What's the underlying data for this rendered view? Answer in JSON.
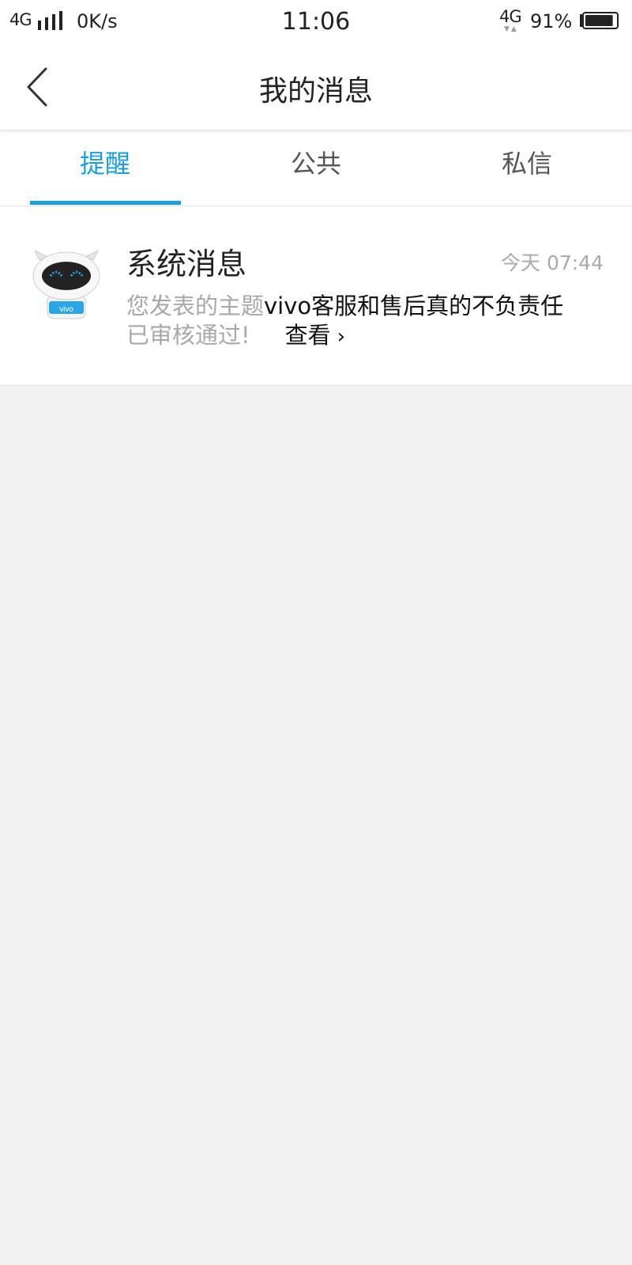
{
  "status_bar": {
    "network_left": "4G",
    "speed": "0K/s",
    "time": "11:06",
    "network_right": "4G",
    "battery": "91%",
    "battery_level": 0.91
  },
  "nav": {
    "title": "我的消息"
  },
  "tabs": [
    {
      "label": "提醒",
      "active": true
    },
    {
      "label": "公共",
      "active": false
    },
    {
      "label": "私信",
      "active": false
    }
  ],
  "colors": {
    "accent": "#1a9fde",
    "background": "#f2f2f2"
  },
  "messages": [
    {
      "avatar_icon": "vivo-robot-avatar",
      "avatar_text": "vivo",
      "title": "系统消息",
      "time": "今天 07:44",
      "body_prefix": "您发表的主题",
      "topic": "vivo客服和售后真的不负责任",
      "body_suffix": "已审核通过!",
      "view_label": "查看",
      "view_chevron": "›"
    }
  ]
}
